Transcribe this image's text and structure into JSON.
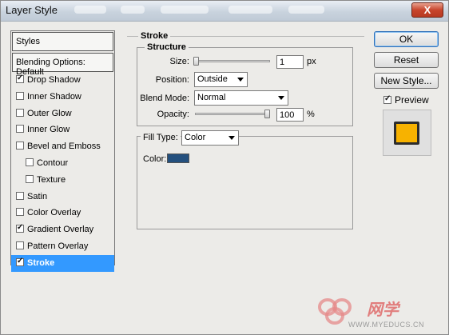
{
  "window": {
    "title": "Layer Style",
    "close_label": "X"
  },
  "styles_panel": {
    "header": "Styles",
    "blending_options": "Blending Options: Default",
    "items": [
      {
        "label": "Drop Shadow",
        "checked": true,
        "indent": false,
        "selected": false
      },
      {
        "label": "Inner Shadow",
        "checked": false,
        "indent": false,
        "selected": false
      },
      {
        "label": "Outer Glow",
        "checked": false,
        "indent": false,
        "selected": false
      },
      {
        "label": "Inner Glow",
        "checked": false,
        "indent": false,
        "selected": false
      },
      {
        "label": "Bevel and Emboss",
        "checked": false,
        "indent": false,
        "selected": false
      },
      {
        "label": "Contour",
        "checked": false,
        "indent": true,
        "selected": false
      },
      {
        "label": "Texture",
        "checked": false,
        "indent": true,
        "selected": false
      },
      {
        "label": "Satin",
        "checked": false,
        "indent": false,
        "selected": false
      },
      {
        "label": "Color Overlay",
        "checked": false,
        "indent": false,
        "selected": false
      },
      {
        "label": "Gradient Overlay",
        "checked": true,
        "indent": false,
        "selected": false
      },
      {
        "label": "Pattern Overlay",
        "checked": false,
        "indent": false,
        "selected": false
      },
      {
        "label": "Stroke",
        "checked": true,
        "indent": false,
        "selected": true
      }
    ]
  },
  "stroke": {
    "section_title": "Stroke",
    "structure_title": "Structure",
    "size_label": "Size:",
    "size_value": "1",
    "size_unit": "px",
    "size_fraction": 0.01,
    "position_label": "Position:",
    "position_value": "Outside",
    "blend_mode_label": "Blend Mode:",
    "blend_mode_value": "Normal",
    "opacity_label": "Opacity:",
    "opacity_value": "100",
    "opacity_unit": "%",
    "opacity_fraction": 1.0,
    "fill_type_label": "Fill Type:",
    "fill_type_value": "Color",
    "color_label": "Color:",
    "color_value": "#24507e"
  },
  "buttons": {
    "ok": "OK",
    "reset": "Reset",
    "new_style": "New Style...",
    "preview_label": "Preview",
    "preview_checked": true
  },
  "preview": {
    "swatch_color": "#f7b200"
  },
  "watermark": {
    "brand": "网学",
    "url": "WWW.MYEDUCS.CN"
  }
}
